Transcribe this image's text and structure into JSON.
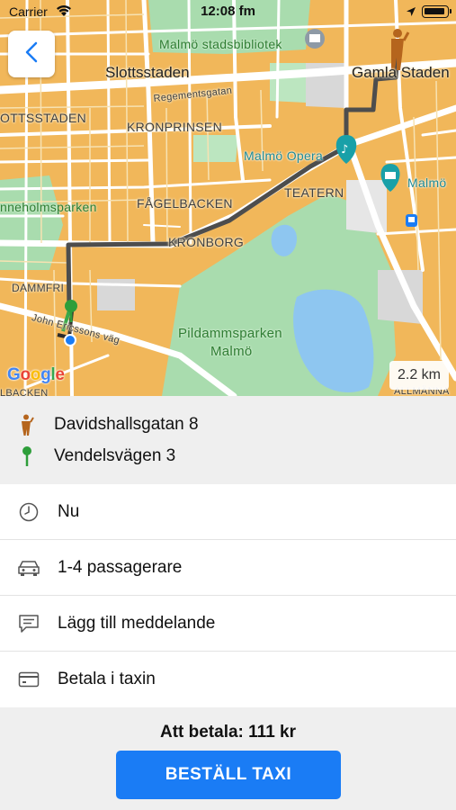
{
  "status_bar": {
    "carrier": "Carrier",
    "time": "12:08 fm"
  },
  "map": {
    "labels": {
      "library": "Malmö stadsbibliotek",
      "slottsstaden": "Slottsstaden",
      "gamla_staden": "Gamla Staden",
      "regementsgatan": "Regementsgatan",
      "slottsstaden_caps": "OTTSSTADEN",
      "kronprinsen": "KRONPRINSEN",
      "opera": "Malmö Opera",
      "teatern": "TEATERN",
      "museum": "Malmö",
      "fagelbacken": "FÅGELBACKEN",
      "park_left": "nneholmsparken",
      "kronborg": "KRONBORG",
      "dammfri": "DAMMFRI",
      "john_ericssons": "John Ericssons väg",
      "pildamm": "Pildammsparken",
      "pildamm2": "Malmö",
      "allmanna": "ALLMÄNNA",
      "bottom_left": "LBACKEN"
    },
    "distance": "2.2 km",
    "attribution": [
      "G",
      "o",
      "o",
      "g",
      "l",
      "e"
    ]
  },
  "route": {
    "pickup": "Davidshallsgatan 8",
    "destination": "Vendelsvägen 3"
  },
  "options": [
    {
      "icon": "clock-icon",
      "label": "Nu"
    },
    {
      "icon": "car-icon",
      "label": "1-4 passagerare"
    },
    {
      "icon": "message-icon",
      "label": "Lägg till meddelande"
    },
    {
      "icon": "card-icon",
      "label": "Betala i taxin"
    }
  ],
  "footer": {
    "price": "Att betala: 111 kr",
    "order_button": "BESTÄLL TAXI"
  },
  "colors": {
    "accent": "#1a7cf5",
    "route": "#4d4d4d",
    "pickup_icon": "#b5651d",
    "destination_icon": "#2e9e3a"
  }
}
